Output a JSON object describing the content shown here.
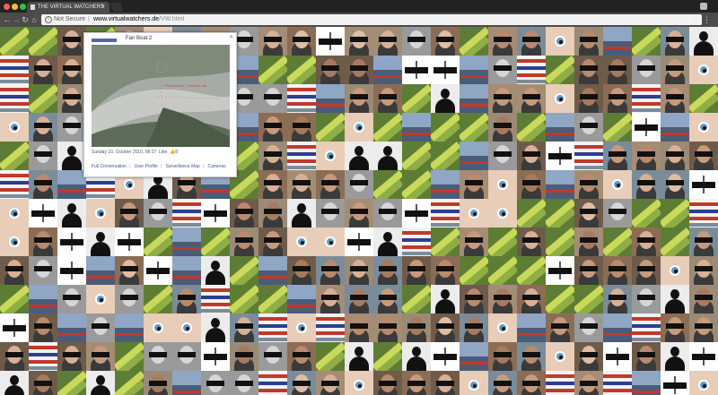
{
  "browser": {
    "tab_title": "THE VIRTUAL WATCHERS",
    "tab_close": "×",
    "security_label": "Not Secure",
    "url_host": "www.virtualwatchers.de",
    "url_path": "/VW.html",
    "back": "←",
    "forward": "→",
    "reload": "↻",
    "home": "⌂",
    "bookmark_icon": "star-icon",
    "menu_icon": "kebab-menu-icon"
  },
  "popup": {
    "title": "Fan Boat 2",
    "camera_overlay": "Pictures are 2 minutes old",
    "date": "Sunday 10. October 2010, 08:27",
    "like_label": "Like",
    "like_count": "8",
    "links": [
      "Full Conversation",
      "User Profile",
      "Surveillance Map",
      "Cameras"
    ]
  },
  "colors": {
    "chrome_dark": "#222222",
    "toolbar": "#4b4b4b",
    "link_blue": "#3b5998"
  }
}
